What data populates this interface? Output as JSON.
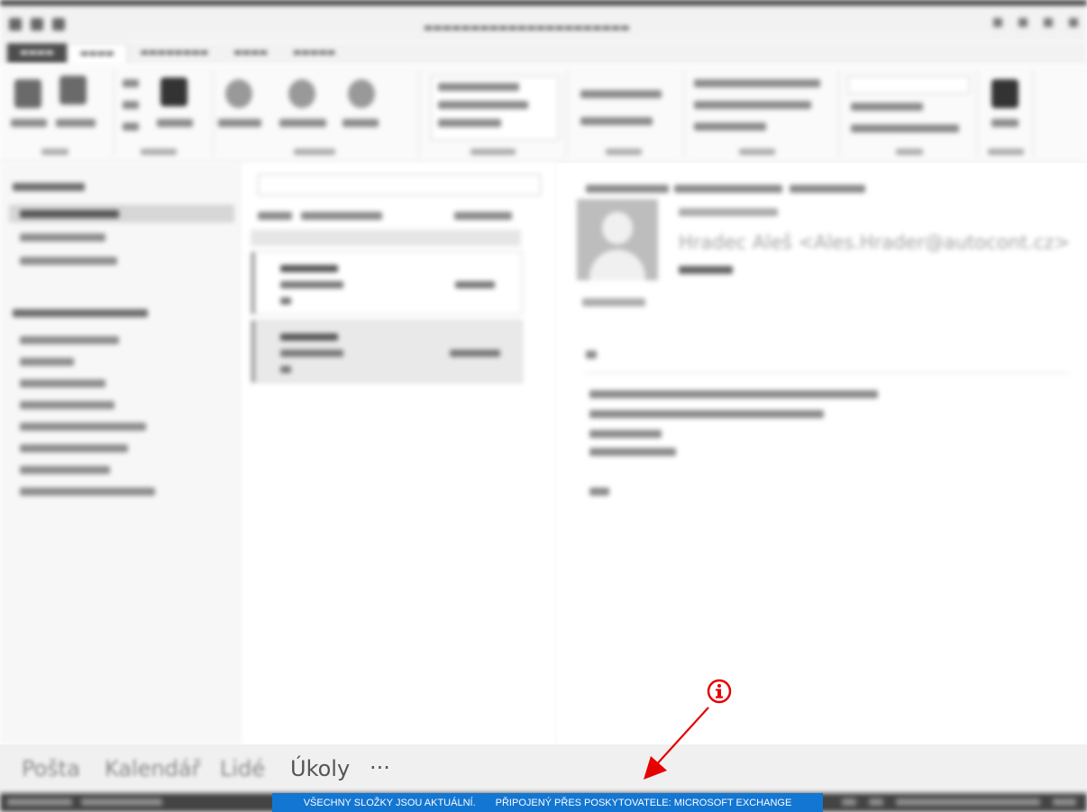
{
  "navigation": {
    "items": [
      "Pošta",
      "Kalendář",
      "Lidé",
      "Úkoly"
    ],
    "more": "···"
  },
  "status": {
    "folders_message": "VŠECHNY SLOŽKY JSOU AKTUÁLNÍ.",
    "connection_message": "PŘIPOJENÝ PŘES POSKYTOVATELE: MICROSOFT EXCHANGE"
  },
  "reading": {
    "sender": "Hradec Aleš <Ales.Hrader@autocont.cz>"
  },
  "annotation": {
    "icon": "info-circle-icon",
    "color": "#e60000"
  },
  "colors": {
    "status_accent": "#1376d2",
    "annotation": "#e60000"
  }
}
